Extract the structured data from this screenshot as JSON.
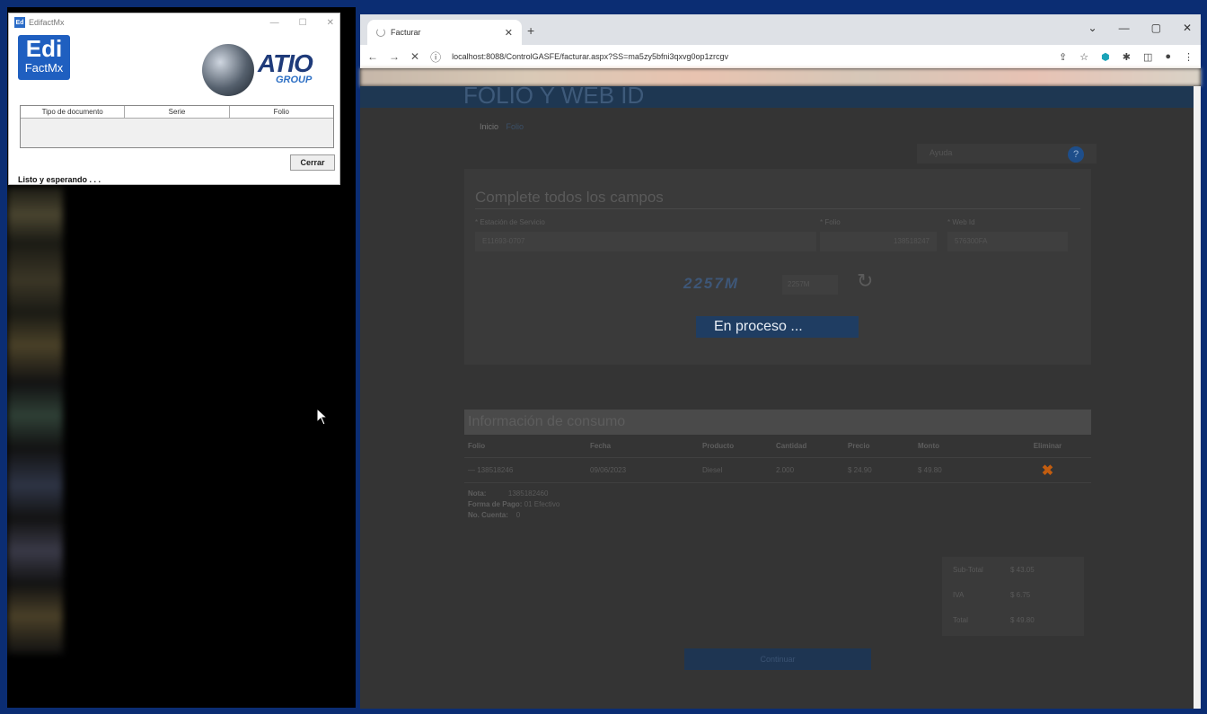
{
  "edi_window": {
    "title": "EdifactMx",
    "logo_top": "Edi",
    "logo_bottom": "FactMx",
    "brand": "ATIO",
    "brand_sub": "GROUP",
    "table_headers": [
      "Tipo de documento",
      "Serie",
      "Folio"
    ],
    "close_label": "Cerrar",
    "status": "Listo y esperando . . ."
  },
  "browser": {
    "tab_title": "Facturar",
    "url": "localhost:8088/ControlGASFE/facturar.aspx?SS=ma5zy5bfni3qxvg0op1zrcgv"
  },
  "page": {
    "hero_title": "FOLIO Y WEB ID",
    "breadcrumb": [
      "Inicio",
      "Folio"
    ],
    "help_placeholder": "Ayuda",
    "form": {
      "title": "Complete todos los campos",
      "station_label": "* Estación de Servicio",
      "station_value": "E11693-0707",
      "folio_label": "* Folio",
      "folio_value": "138518247",
      "webid_label": "* Web Id",
      "webid_value": "576300FA",
      "captcha_text": "2257M",
      "captcha_input": "2257M"
    },
    "overlay_text": "En proceso ...",
    "consumption": {
      "title": "Información de consumo",
      "columns": [
        "Folio",
        "Fecha",
        "Producto",
        "Cantidad",
        "Precio",
        "Monto",
        "Eliminar"
      ],
      "row": {
        "folio": "— 138518246",
        "fecha": "09/06/2023",
        "producto": "Diesel",
        "cantidad": "2.000",
        "precio": "$ 24.90",
        "monto": "$ 49.80"
      },
      "nota_label": "Nota:",
      "nota_value": "1385182460",
      "forma_label": "Forma de Pago:",
      "forma_value": "01 Efectivo",
      "cuenta_label": "No. Cuenta:",
      "cuenta_value": "0"
    },
    "totals": {
      "subtotal_label": "Sub-Total",
      "subtotal_value": "$ 43.05",
      "iva_label": "IVA",
      "iva_value": "$ 6.75",
      "total_label": "Total",
      "total_value": "$ 49.80"
    },
    "continue_label": "Continuar"
  }
}
